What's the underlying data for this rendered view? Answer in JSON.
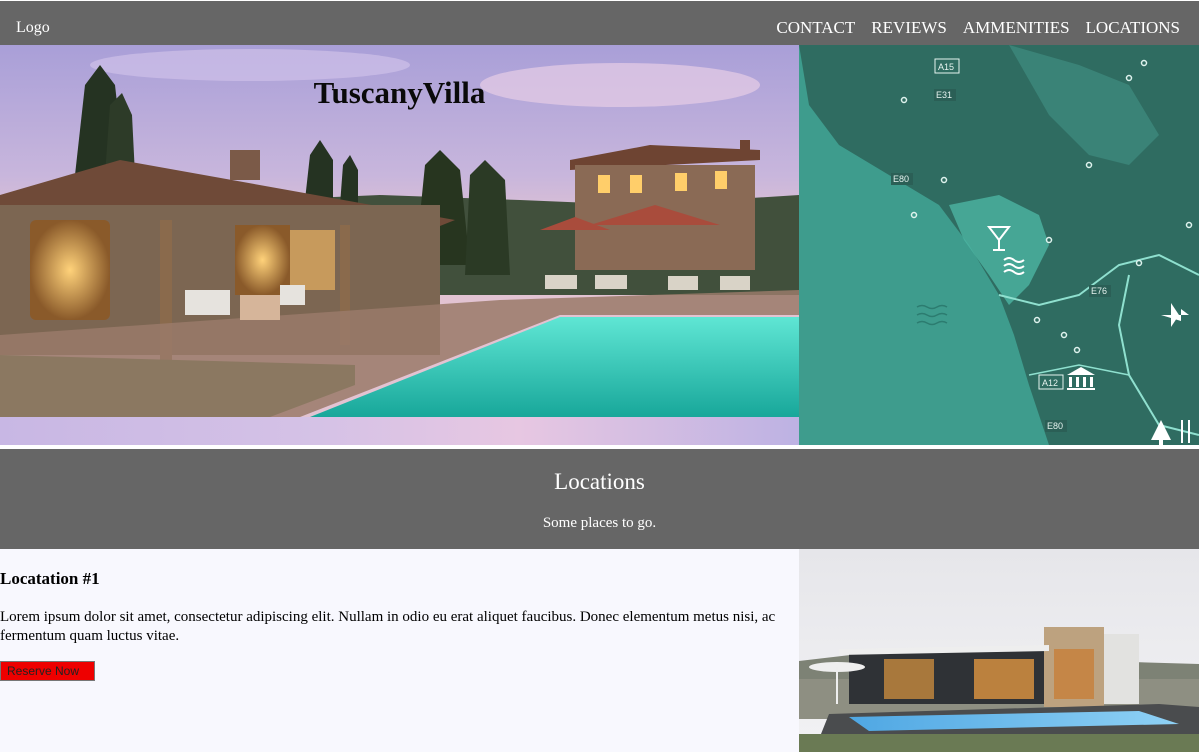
{
  "nav": {
    "logo": "Logo",
    "links": [
      "CONTACT",
      "REVIEWS",
      "AMMENITIES",
      "LOCATIONS"
    ]
  },
  "hero": {
    "title": "TuscanyVilla"
  },
  "map": {
    "road_labels": [
      "A15",
      "E31",
      "E80",
      "E76",
      "A12",
      "E80"
    ]
  },
  "locations": {
    "title": "Locations",
    "subtitle": "Some places to go."
  },
  "location1": {
    "heading": "Locatation #1",
    "text": "Lorem ipsum dolor sit amet, consectetur adipiscing elit. Nullam in odio eu erat aliquet faucibus. Donec elementum metus nisi, ac fermentum quam luctus vitae.",
    "button": "Reserve Now"
  },
  "colors": {
    "nav_bg": "#666666",
    "map_bg": "#3c9a8c",
    "button_red": "#ee0000",
    "content_bg": "#f8f8fe"
  }
}
